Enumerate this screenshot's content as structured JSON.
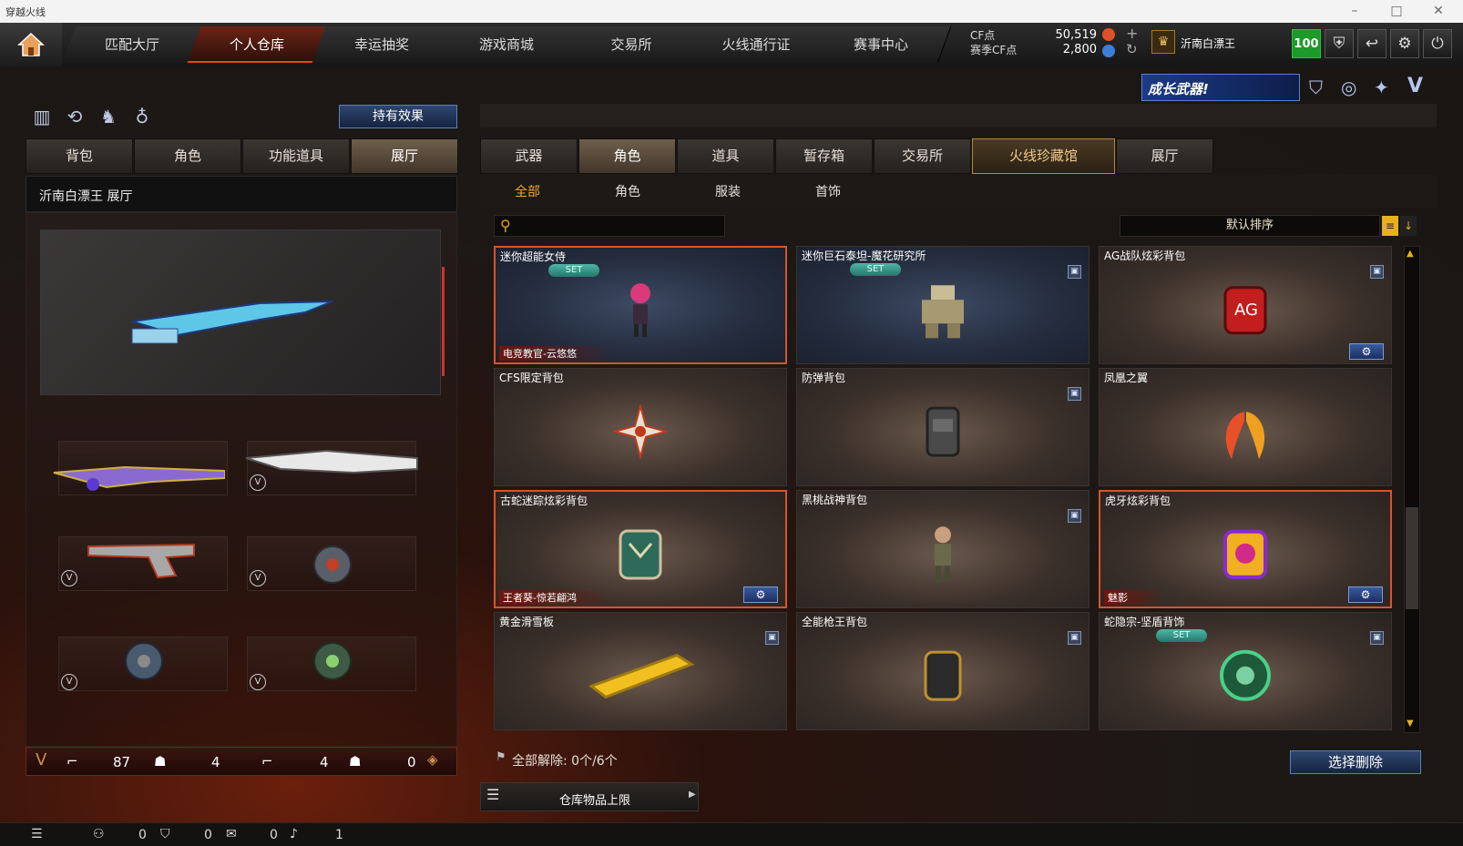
{
  "window": {
    "title": "穿越火线"
  },
  "nav": {
    "tabs": [
      "匹配大厅",
      "个人仓库",
      "幸运抽奖",
      "游戏商城",
      "交易所",
      "火线通行证",
      "赛事中心"
    ],
    "active_index": 1
  },
  "currency": {
    "cf_label": "CF点",
    "cf_value": "50,519",
    "season_label": "赛季CF点",
    "season_value": "2,800"
  },
  "player": {
    "name": "沂南白漂王",
    "level": "100"
  },
  "banner": {
    "text": "成长武器!"
  },
  "left": {
    "effect_button": "持有效果",
    "tabs": [
      "背包",
      "角色",
      "功能道具",
      "展厅"
    ],
    "active_tab": 3,
    "hall_title": "沂南白漂王 展厅",
    "stats": {
      "guns": "87",
      "heads1": "4",
      "guns2": "4",
      "heads2": "0"
    }
  },
  "right": {
    "tabs": [
      "武器",
      "角色",
      "道具",
      "暂存箱",
      "交易所",
      "火线珍藏馆",
      "展厅"
    ],
    "active_tab": 1,
    "highlight_tab": 5,
    "filters": [
      "全部",
      "角色",
      "服装",
      "首饰"
    ],
    "active_filter": 0,
    "search_placeholder": "",
    "sort_label": "默认排序",
    "set_label": "SET",
    "items": [
      {
        "name": "迷你超能女侍",
        "set": true,
        "sub": "电竞教官-云悠悠",
        "style": "blue",
        "selected": true,
        "lock": false,
        "gear": false,
        "icon": "pink-girl-icon"
      },
      {
        "name": "迷你巨石泰坦-魔花研究所",
        "set": true,
        "sub": "",
        "style": "blue",
        "selected": false,
        "lock": true,
        "gear": false,
        "icon": "titan-robot-icon"
      },
      {
        "name": "AG战队炫彩背包",
        "set": false,
        "sub": "",
        "style": "brown",
        "selected": false,
        "lock": true,
        "gear": true,
        "icon": "ag-backpack-icon"
      },
      {
        "name": "CFS限定背包",
        "set": false,
        "sub": "",
        "style": "brown",
        "selected": false,
        "lock": false,
        "gear": false,
        "icon": "star-emblem-icon"
      },
      {
        "name": "防弹背包",
        "set": false,
        "sub": "",
        "style": "brown",
        "selected": false,
        "lock": true,
        "gear": false,
        "icon": "armor-backpack-icon"
      },
      {
        "name": "凤凰之翼",
        "set": false,
        "sub": "",
        "style": "brown",
        "selected": false,
        "lock": false,
        "gear": false,
        "icon": "phoenix-wings-icon"
      },
      {
        "name": "古蛇迷踪炫彩背包",
        "set": false,
        "sub": "王者葵-惊若翩鸿",
        "style": "brown",
        "selected": true,
        "lock": false,
        "gear": true,
        "icon": "snake-backpack-icon"
      },
      {
        "name": "黑桃战神背包",
        "set": false,
        "sub": "",
        "style": "brown",
        "selected": false,
        "lock": true,
        "gear": false,
        "icon": "soldier-figure-icon"
      },
      {
        "name": "虎牙炫彩背包",
        "set": false,
        "sub": "魅影",
        "style": "brown",
        "selected": true,
        "lock": false,
        "gear": true,
        "icon": "huya-backpack-icon"
      },
      {
        "name": "黄金滑雪板",
        "set": false,
        "sub": "",
        "style": "brown",
        "selected": false,
        "lock": true,
        "gear": false,
        "icon": "golden-snowboard-icon"
      },
      {
        "name": "全能枪王背包",
        "set": false,
        "sub": "",
        "style": "brown",
        "selected": false,
        "lock": true,
        "gear": false,
        "icon": "gunking-backpack-icon"
      },
      {
        "name": "蛇隐宗-坚盾背饰",
        "set": true,
        "sub": "",
        "style": "brown",
        "selected": false,
        "lock": true,
        "gear": false,
        "icon": "green-shield-icon"
      }
    ],
    "release_label": "全部解除: 0个/6个",
    "delete_button": "选择删除",
    "capacity_label": "仓库物品上限"
  },
  "status": {
    "c1": "0",
    "c2": "0",
    "c3": "0",
    "c4": "1"
  },
  "colors": {
    "accent": "#d94a1c",
    "blue_button": "#2e4670",
    "green_level": "#1c9a2a",
    "gold": "#f1c98a"
  }
}
